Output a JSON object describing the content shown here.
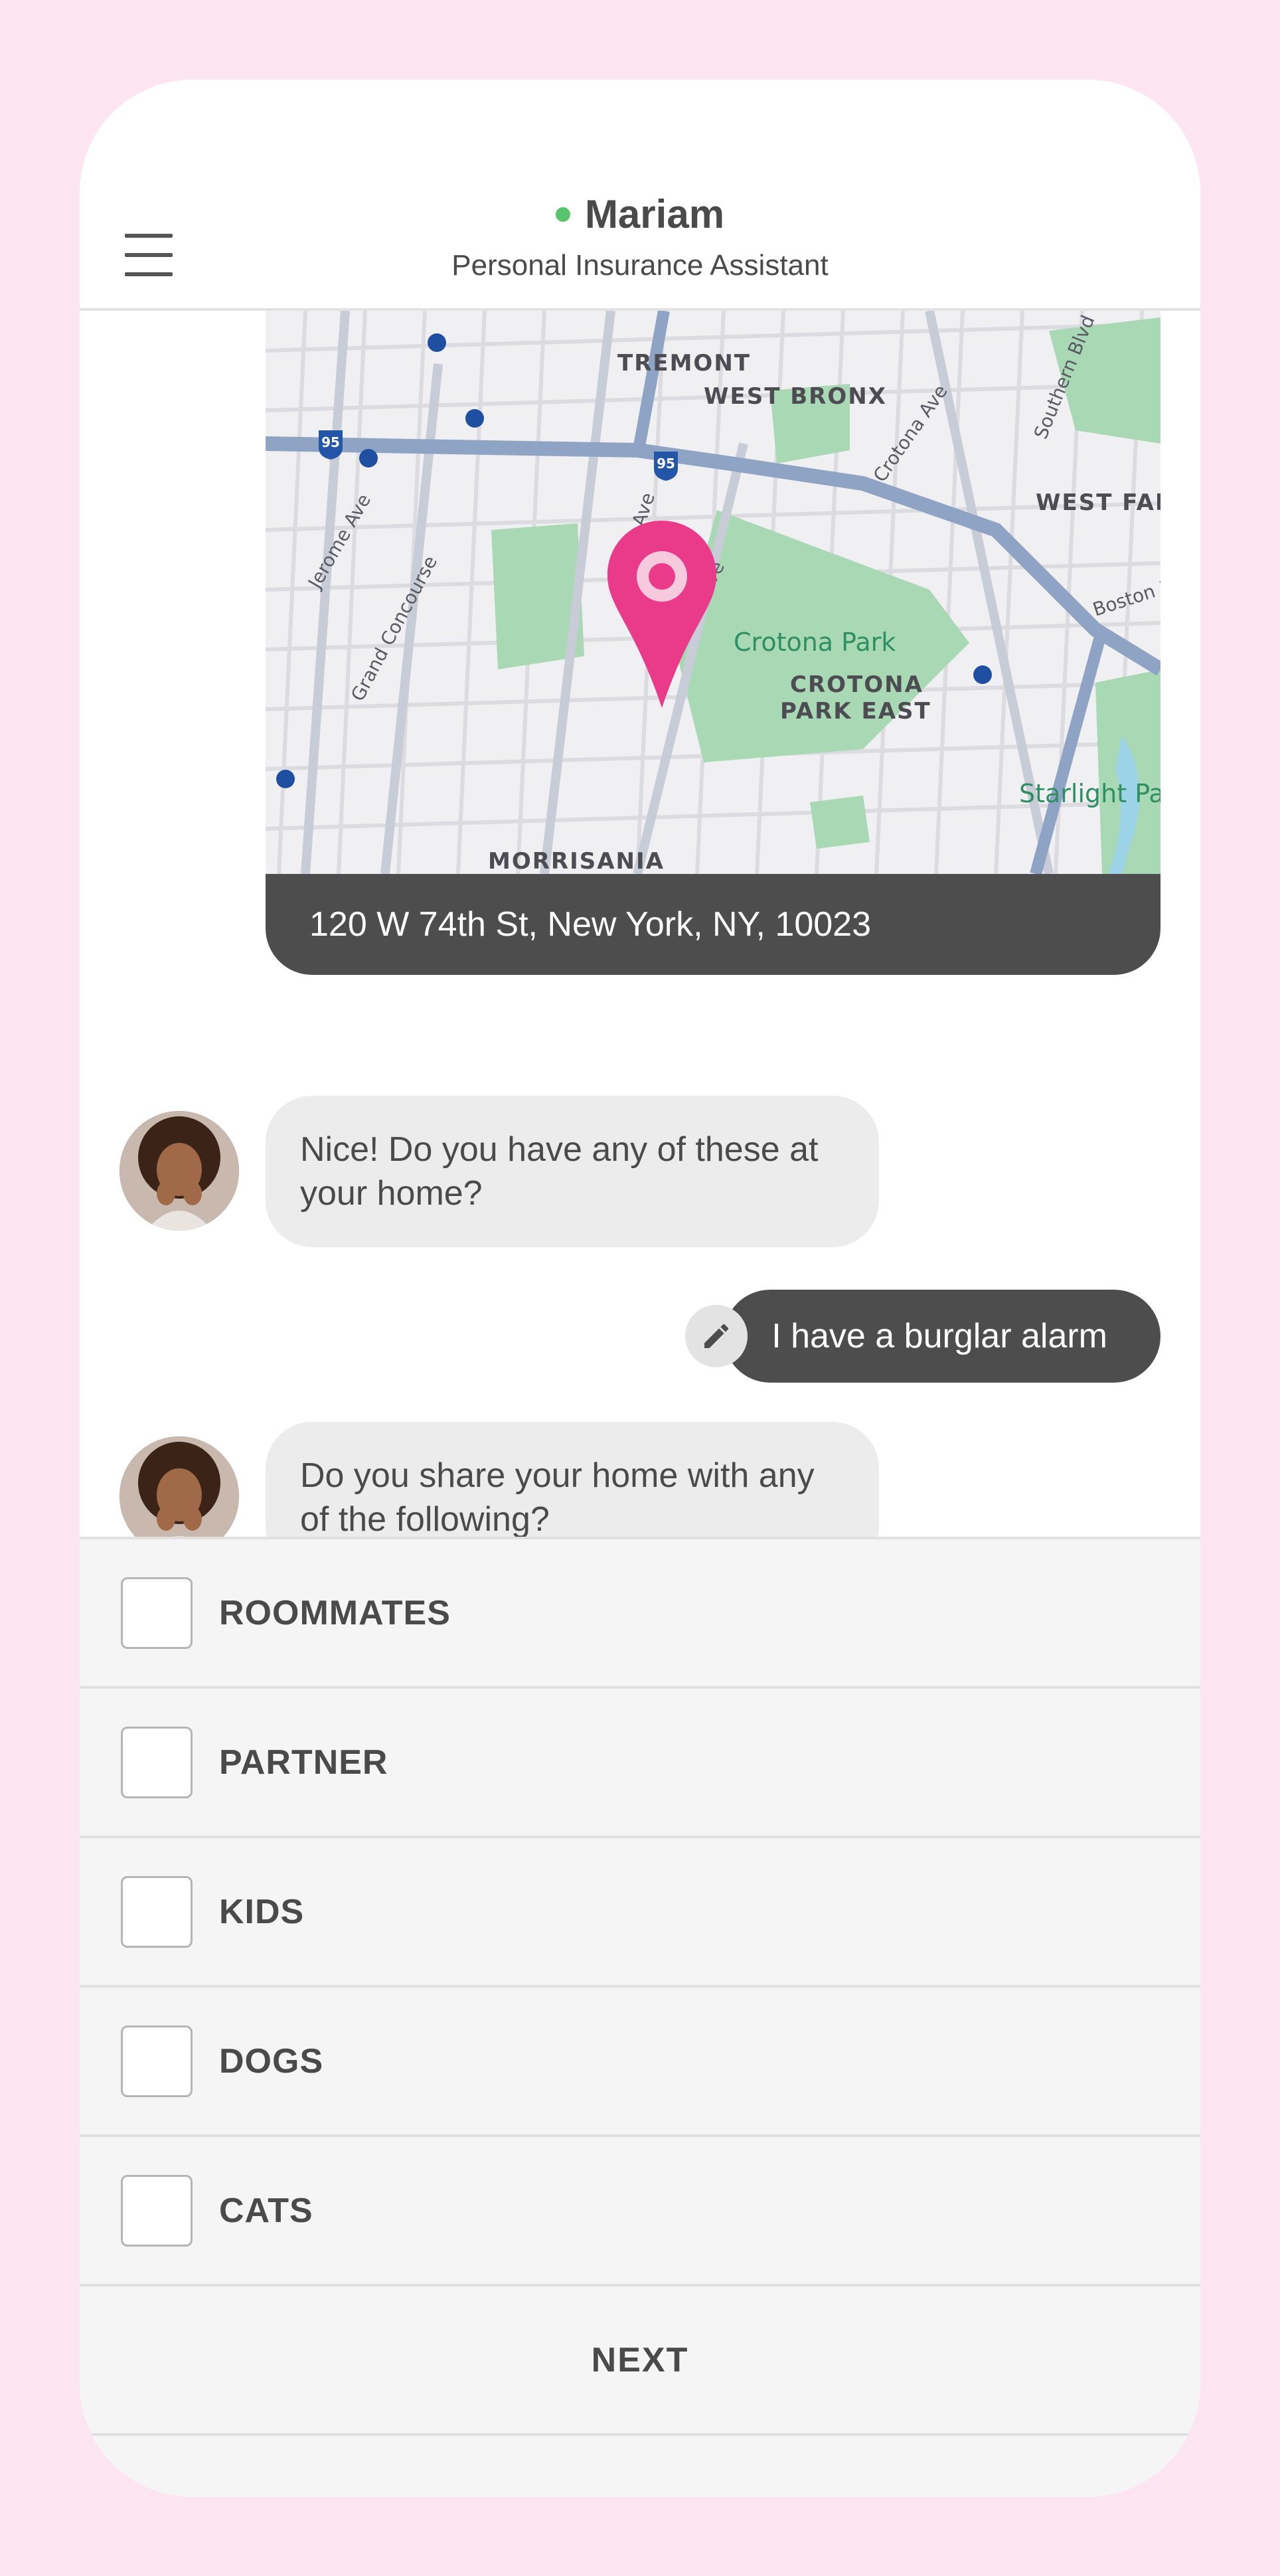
{
  "header": {
    "name": "Mariam",
    "subtitle": "Personal Insurance Assistant",
    "status_color": "#58c46b"
  },
  "map": {
    "address": "120 W 74th St, New York, NY, 10023",
    "pin_color": "#ea3a8a",
    "labels": {
      "tremont": "TREMONT",
      "west_bronx": "WEST BRONX",
      "west_farms": "WEST FAR",
      "crotona_park": "Crotona Park",
      "crotona_park_east_1": "CROTONA",
      "crotona_park_east_2": "PARK EAST",
      "starlight_park": "Starlight Pa",
      "morrisania": "MORRISANIA",
      "jerome_ave": "Jerome Ave",
      "grand_concourse": "Grand Concourse",
      "webster_ave": "ebster Ave",
      "third_ave": "Third Ave",
      "crotona_ave": "Crotona Ave",
      "southern_blvd": "Southern Blvd",
      "boston_rd": "Boston R",
      "i95_a": "95",
      "i95_b": "95"
    }
  },
  "messages": {
    "q1": "Nice! Do you have any of these at your home?",
    "a1": "I have a burglar alarm",
    "q2": "Do you share your home with any of the following?"
  },
  "options": [
    {
      "label": "ROOMMATES",
      "checked": false
    },
    {
      "label": "PARTNER",
      "checked": false
    },
    {
      "label": "KIDS",
      "checked": false
    },
    {
      "label": "DOGS",
      "checked": false
    },
    {
      "label": "CATS",
      "checked": false
    }
  ],
  "next_label": "NEXT",
  "icons": {
    "menu": "hamburger-menu-icon",
    "edit": "pencil-icon",
    "pin": "map-pin-icon"
  }
}
